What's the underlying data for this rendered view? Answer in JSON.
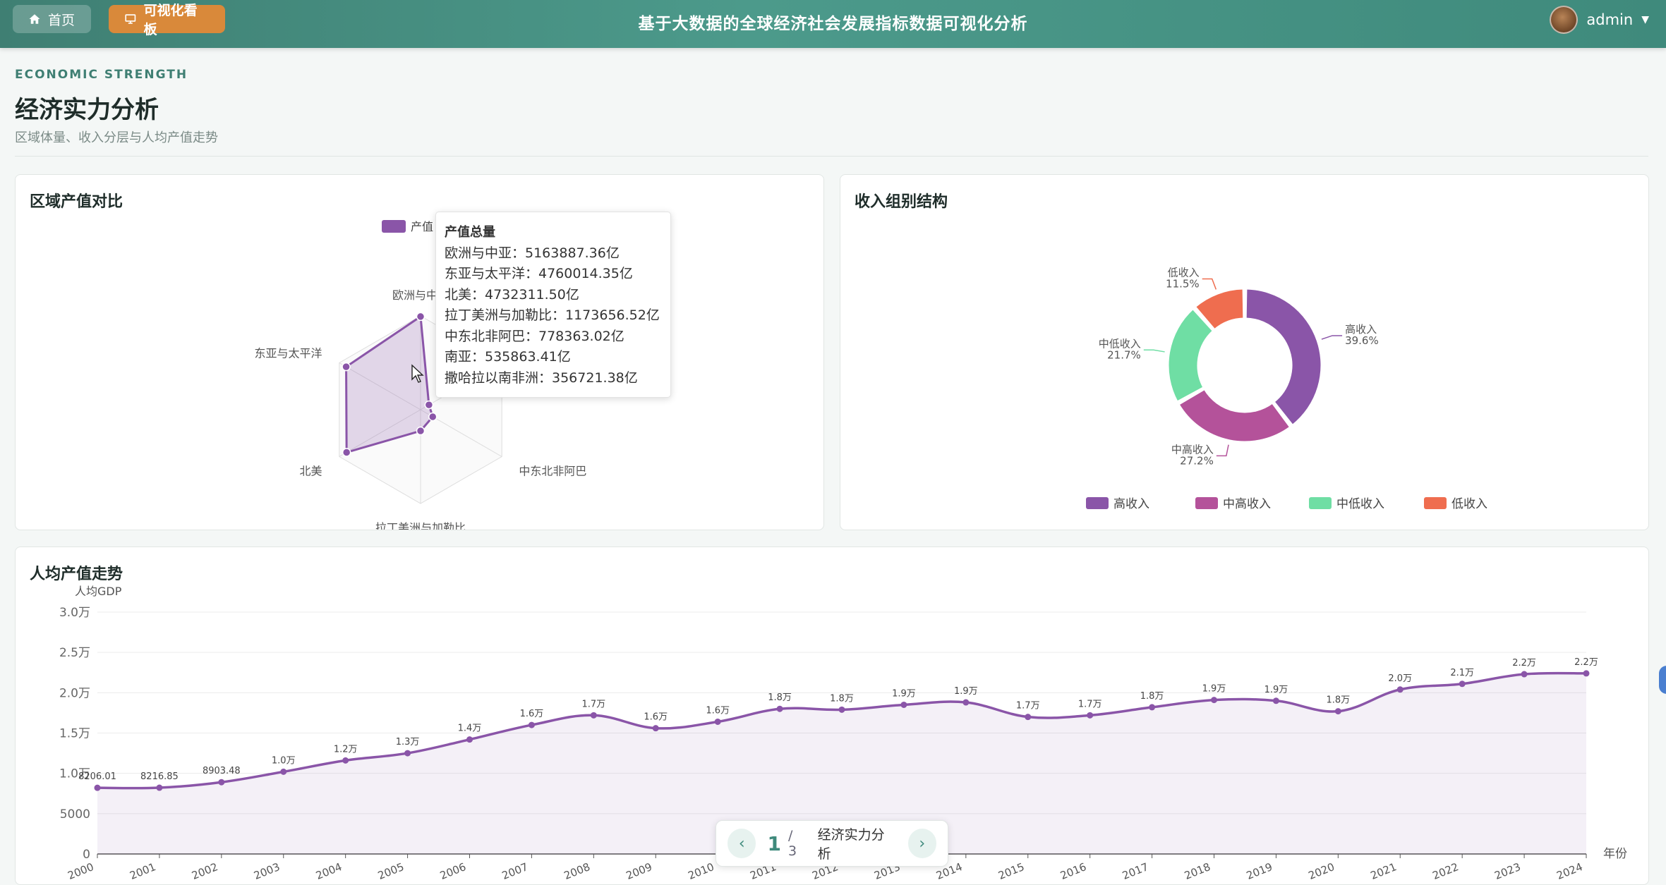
{
  "topbar": {
    "home_label": "首页",
    "dashboard_label": "可视化看板",
    "title": "基于大数据的全球经济社会发展指标数据可视化分析",
    "username": "admin"
  },
  "header": {
    "eyebrow": "ECONOMIC STRENGTH",
    "title": "经济实力分析",
    "subtitle": "区域体量、收入分层与人均产值走势"
  },
  "radar_card": {
    "title": "区域产值对比"
  },
  "donut_card": {
    "title": "收入组别结构"
  },
  "line_card": {
    "title": "人均产值走势"
  },
  "tooltip": {
    "title": "产值总量",
    "lines": [
      "欧洲与中亚：5163887.36亿",
      "东亚与太平洋：4760014.35亿",
      "北美：4732311.50亿",
      "拉丁美洲与加勒比：1173656.52亿",
      "中东北非阿巴：778363.02亿",
      "南亚：535863.41亿",
      "撒哈拉以南非洲：356721.38亿"
    ]
  },
  "pager": {
    "current": "1",
    "total": "/ 3",
    "name": "经济实力分析"
  },
  "colors": {
    "purple": "#8a55a8",
    "magenta": "#b4529a",
    "mint": "#6fdea4",
    "coral": "#ef6d4f",
    "teal": "#3f7f73",
    "orange": "#d9893a"
  },
  "chart_data": [
    {
      "type": "radar",
      "legend": [
        "产值"
      ],
      "indicators": [
        "欧洲与中亚",
        "南亚",
        "中东北非阿巴",
        "拉丁美洲与加勒比",
        "北美",
        "东亚与太平洋"
      ],
      "values": [
        5163887.36,
        535863.41,
        778363.02,
        1173656.52,
        4732311.5,
        4760014.35
      ],
      "max": 5200000,
      "legend_position": "top"
    },
    {
      "type": "pie",
      "donut": true,
      "categories": [
        "高收入",
        "中高收入",
        "中低收入",
        "低收入"
      ],
      "values": [
        39.6,
        27.2,
        21.7,
        11.5
      ],
      "labels": [
        "39.6%",
        "27.2%",
        "21.7%",
        "11.5%"
      ],
      "legend_position": "bottom"
    },
    {
      "type": "area",
      "ylabel": "人均GDP",
      "xlabel": "年份",
      "x": [
        "2000",
        "2001",
        "2002",
        "2003",
        "2004",
        "2005",
        "2006",
        "2007",
        "2008",
        "2009",
        "2010",
        "2011",
        "2012",
        "2013",
        "2014",
        "2015",
        "2016",
        "2017",
        "2018",
        "2019",
        "2020",
        "2021",
        "2022",
        "2023",
        "2024"
      ],
      "values": [
        8206.01,
        8216.85,
        8903.48,
        10200,
        11600,
        12500,
        14200,
        16000,
        17200,
        15600,
        16400,
        18000,
        17900,
        18500,
        18800,
        17000,
        17200,
        18200,
        19100,
        19000,
        17700,
        20400,
        21100,
        22300,
        22400
      ],
      "data_labels": [
        "8206.01",
        "8216.85",
        "8903.48",
        "1.0万",
        "1.2万",
        "1.3万",
        "1.4万",
        "1.6万",
        "1.7万",
        "1.6万",
        "1.6万",
        "1.8万",
        "1.8万",
        "1.9万",
        "1.9万",
        "1.7万",
        "1.7万",
        "1.8万",
        "1.9万",
        "1.9万",
        "1.8万",
        "2.0万",
        "2.1万",
        "2.2万",
        "2.2万"
      ],
      "yticks": [
        "0",
        "5000",
        "1.0万",
        "1.5万",
        "2.0万",
        "2.5万",
        "3.0万"
      ],
      "ylim": [
        0,
        30000
      ]
    }
  ]
}
